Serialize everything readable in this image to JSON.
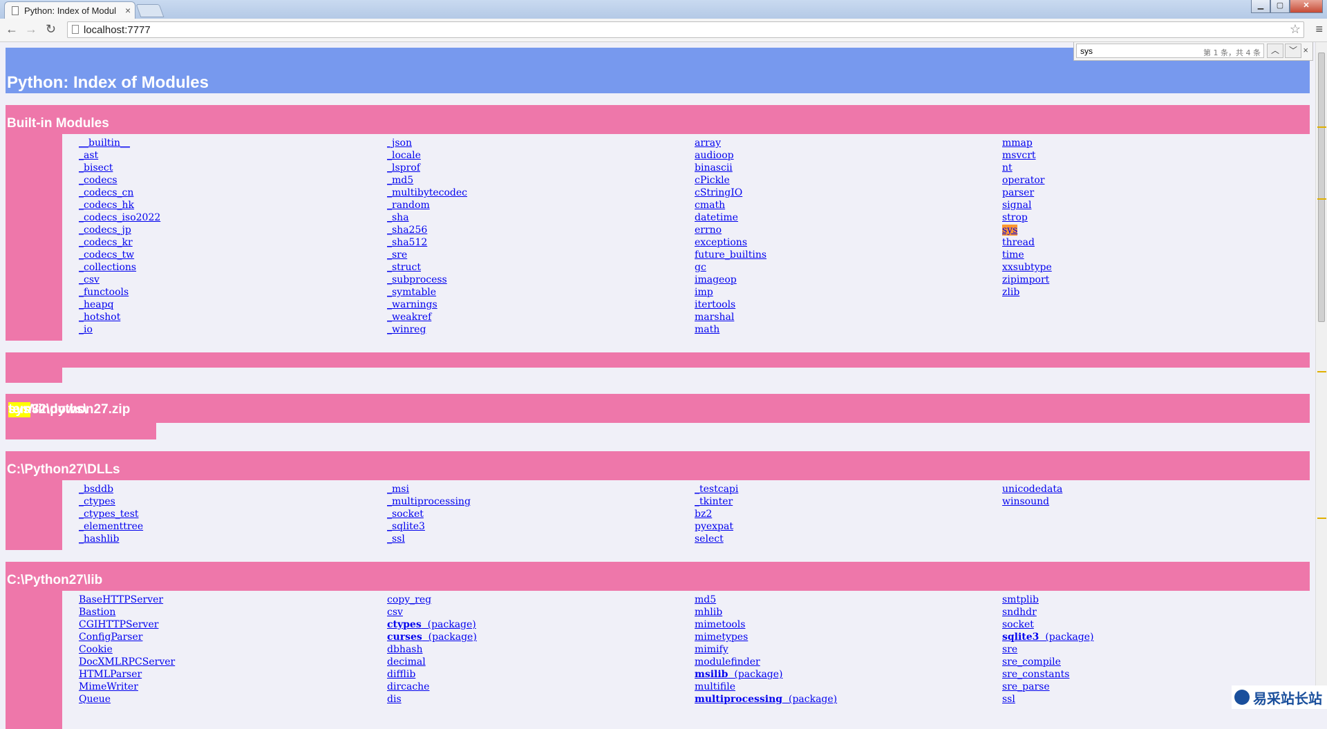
{
  "browser": {
    "tab_title": "Python: Index of Modul",
    "tab_close": "×",
    "url": "localhost:7777"
  },
  "find_bar": {
    "query": "sys",
    "count": "第 1 条，共 4 条",
    "prev": "⌃",
    "next": "⌄",
    "close": "×"
  },
  "page": {
    "title": "Python: Index of Modules"
  },
  "builtin": {
    "title": "Built-in Modules",
    "columns": [
      [
        "__builtin__",
        "_ast",
        "_bisect",
        "_codecs",
        "_codecs_cn",
        "_codecs_hk",
        "_codecs_iso2022",
        "_codecs_jp",
        "_codecs_kr",
        "_codecs_tw",
        "_collections",
        "_csv",
        "_functools",
        "_heapq",
        "_hotshot",
        "_io"
      ],
      [
        "_json",
        "_locale",
        "_lsprof",
        "_md5",
        "_multibytecodec",
        "_random",
        "_sha",
        "_sha256",
        "_sha512",
        "_sre",
        "_struct",
        "_subprocess",
        "_symtable",
        "_warnings",
        "_weakref",
        "_winreg"
      ],
      [
        "array",
        "audioop",
        "binascii",
        "cPickle",
        "cStringIO",
        "cmath",
        "datetime",
        "errno",
        "exceptions",
        "future_builtins",
        "gc",
        "imageop",
        "imp",
        "itertools",
        "marshal",
        "math"
      ],
      [
        "mmap",
        "msvcrt",
        "nt",
        "operator",
        "parser",
        "signal",
        "strop",
        "sys",
        "thread",
        "time",
        "xxsubtype",
        "zipimport",
        "zlib"
      ]
    ]
  },
  "zip_section": {
    "title_pre": "C:\\Windows\\",
    "title_hl": "sys",
    "title_post": "tem32\\python27.zip"
  },
  "dlls": {
    "title": "C:\\Python27\\DLLs",
    "columns": [
      [
        "_bsddb",
        "_ctypes",
        "_ctypes_test",
        "_elementtree",
        "_hashlib"
      ],
      [
        "_msi",
        "_multiprocessing",
        "_socket",
        "_sqlite3",
        "_ssl"
      ],
      [
        "_testcapi",
        "_tkinter",
        "bz2",
        "pyexpat",
        "select"
      ],
      [
        "unicodedata",
        "winsound"
      ]
    ]
  },
  "lib": {
    "title": "C:\\Python27\\lib",
    "columns": [
      [
        "BaseHTTPServer",
        "Bastion",
        "CGIHTTPServer",
        "ConfigParser",
        "Cookie",
        "DocXMLRPCServer",
        "HTMLParser",
        "MimeWriter",
        "Queue"
      ],
      [
        "copy_reg",
        "csv",
        "ctypes (package)",
        "curses (package)",
        "dbhash",
        "decimal",
        "difflib",
        "dircache",
        "dis"
      ],
      [
        "md5",
        "mhlib",
        "mimetools",
        "mimetypes",
        "mimify",
        "modulefinder",
        "msilib (package)",
        "multifile",
        "multiprocessing (package)"
      ],
      [
        "smtplib",
        "sndhdr",
        "socket",
        "sqlite3 (package)",
        "sre",
        "sre_compile",
        "sre_constants",
        "sre_parse",
        "ssl"
      ]
    ]
  },
  "watermark": {
    "text": "易采站长站"
  }
}
